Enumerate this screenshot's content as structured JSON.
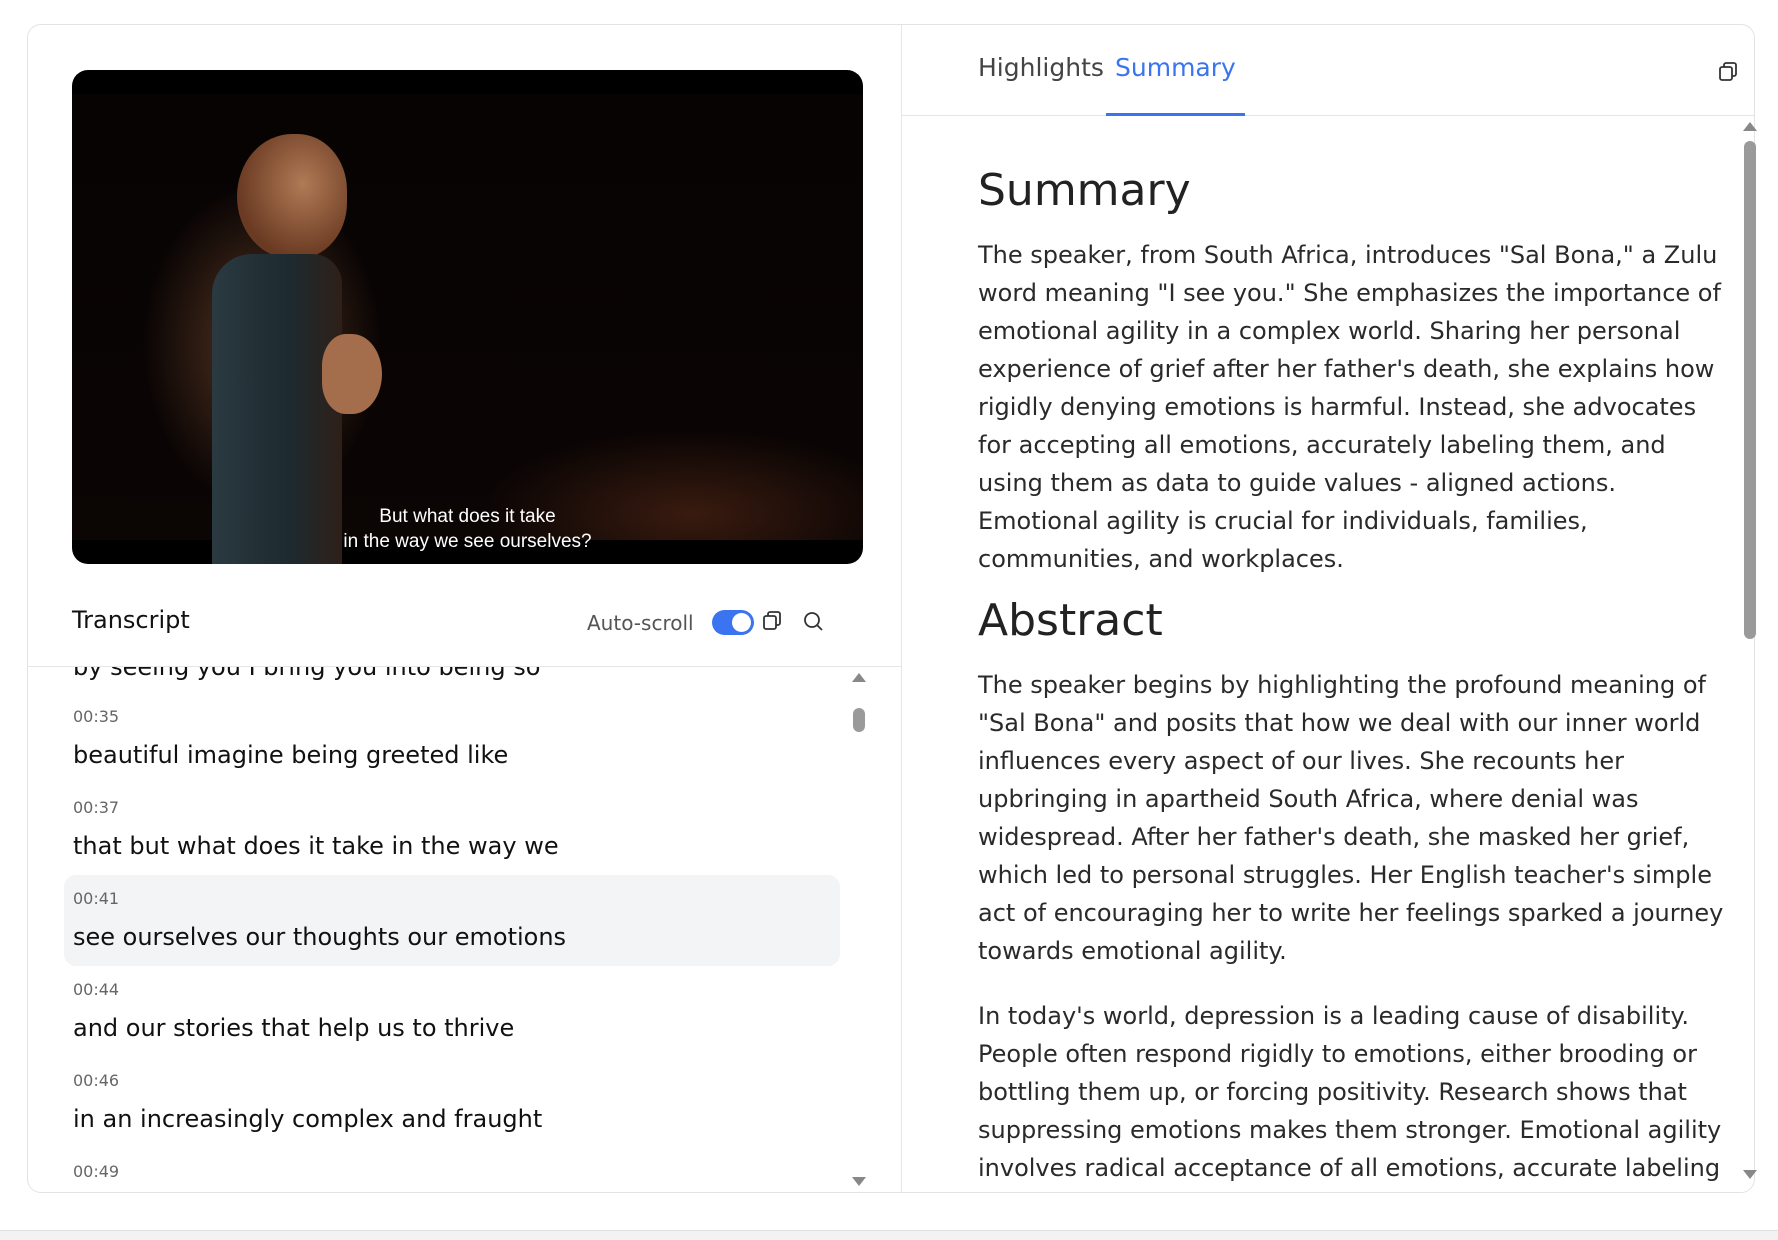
{
  "video": {
    "subtitle_line1": "But what does it take",
    "subtitle_line2": "in the way we see ourselves?"
  },
  "transcript": {
    "title": "Transcript",
    "autoscroll_label": "Auto-scroll",
    "autoscroll_on": true,
    "partial_line": "by seeing you I bring you into being so",
    "items": [
      {
        "time": "00:35",
        "text": "beautiful imagine being greeted like",
        "active": false
      },
      {
        "time": "00:37",
        "text": "that but what does it take in the way we",
        "active": false
      },
      {
        "time": "00:41",
        "text": "see ourselves our thoughts our emotions",
        "active": true
      },
      {
        "time": "00:44",
        "text": "and our stories that help us to thrive",
        "active": false
      },
      {
        "time": "00:46",
        "text": "in an increasingly complex and fraught",
        "active": false
      },
      {
        "time": "00:49",
        "text": "",
        "active": false
      }
    ]
  },
  "tabs": {
    "highlights": "Highlights",
    "summary": "Summary",
    "active": "summary"
  },
  "summary": {
    "heading": "Summary",
    "text": "The speaker, from South Africa, introduces \"Sal Bona,\" a Zulu word meaning \"I see you.\" She emphasizes the importance of emotional agility in a complex world. Sharing her personal experience of grief after her father's death, she explains how rigidly denying emotions is harmful. Instead, she advocates for accepting all emotions, accurately labeling them, and using them as data to guide values - aligned actions. Emotional agility is crucial for individuals, families, communities, and workplaces.",
    "abstract_heading": "Abstract",
    "abstract_p1": "The speaker begins by highlighting the profound meaning of \"Sal Bona\" and posits that how we deal with our inner world influences every aspect of our lives. She recounts her upbringing in apartheid South Africa, where denial was widespread. After her father's death, she masked her grief, which led to personal struggles. Her English teacher's simple act of encouraging her to write her feelings sparked a journey towards emotional agility.",
    "abstract_p2": "In today's world, depression is a leading cause of disability. People often respond rigidly to emotions, either brooding or bottling them up, or forcing positivity. Research shows that suppressing emotions makes them stronger. Emotional agility involves radical acceptance of all emotions, accurate labeling and using emotions as data to outline the qualities and directions"
  },
  "colors": {
    "accent": "#3b74f0",
    "active_row": "#f3f4f6"
  }
}
